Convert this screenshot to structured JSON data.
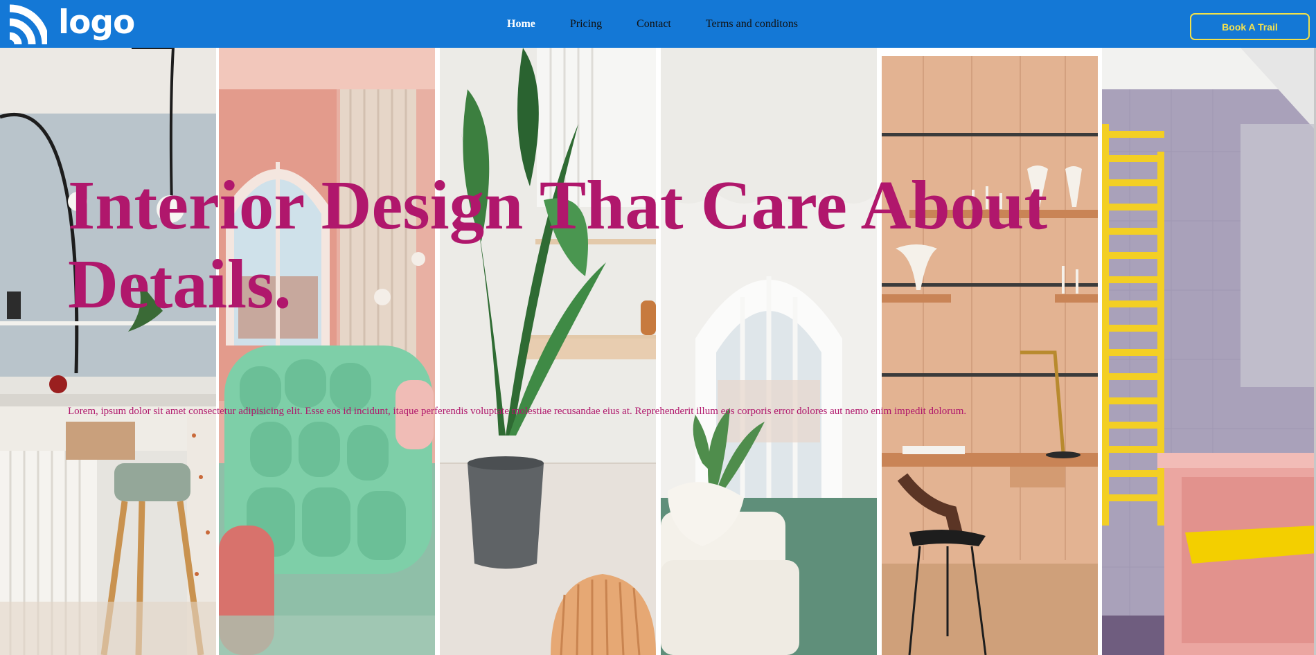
{
  "brand": {
    "logo_text": "logo",
    "logo_icon": "wifi-arcs-icon"
  },
  "nav": {
    "items": [
      {
        "label": "Home",
        "active": true
      },
      {
        "label": "Pricing",
        "active": false
      },
      {
        "label": "Contact",
        "active": false
      },
      {
        "label": "Terms and conditons",
        "active": false
      }
    ]
  },
  "cta": {
    "label": "Book A Trail"
  },
  "hero": {
    "title": "Interior Design That Care About Details.",
    "text": "Lorem, ipsum dolor sit amet consectetur adipisicing elit. Esse eos id incidunt, itaque perferendis voluptate molestiae recusandae eius at. Reprehenderit illum eos corporis error dolores aut nemo enim impedit dolorum."
  },
  "colors": {
    "navbar": "#1478d6",
    "accent": "#b0176c",
    "cta_border": "#f1e04a"
  }
}
